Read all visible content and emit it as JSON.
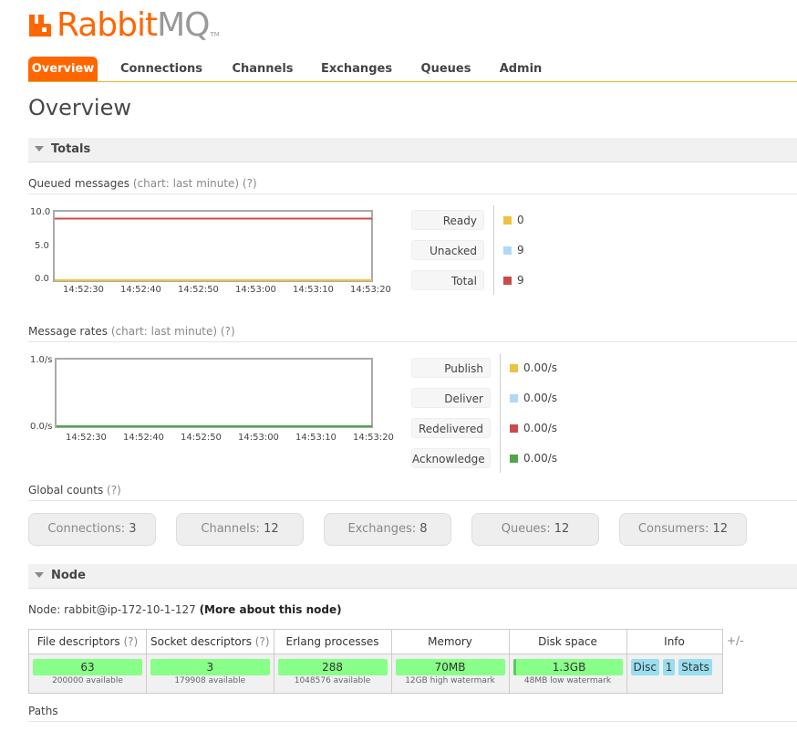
{
  "app": {
    "logo_rabbit": "Rabbit",
    "logo_mq": "MQ",
    "logo_tm": "TM"
  },
  "nav": {
    "tabs": [
      {
        "label": "Overview",
        "active": true
      },
      {
        "label": "Connections"
      },
      {
        "label": "Channels"
      },
      {
        "label": "Exchanges"
      },
      {
        "label": "Queues"
      },
      {
        "label": "Admin"
      }
    ]
  },
  "page_title": "Overview",
  "totals": {
    "section_title": "Totals",
    "queued": {
      "label": "Queued messages",
      "hint": "(chart: last minute) (?)",
      "legend": [
        {
          "label": "Ready",
          "value": "0",
          "color": "#edc240"
        },
        {
          "label": "Unacked",
          "value": "9",
          "color": "#afd8f8"
        },
        {
          "label": "Total",
          "value": "9",
          "color": "#cb4b4b"
        }
      ]
    },
    "rates": {
      "label": "Message rates",
      "hint": "(chart: last minute) (?)",
      "legend": [
        {
          "label": "Publish",
          "value": "0.00/s",
          "color": "#edc240"
        },
        {
          "label": "Deliver",
          "value": "0.00/s",
          "color": "#afd8f8"
        },
        {
          "label": "Redelivered",
          "value": "0.00/s",
          "color": "#cb4b4b"
        },
        {
          "label": "Acknowledge",
          "value": "0.00/s",
          "color": "#4da74d"
        }
      ]
    },
    "global_counts": {
      "label": "Global counts",
      "hint": "(?)",
      "items": [
        {
          "label": "Connections:",
          "value": "3"
        },
        {
          "label": "Channels:",
          "value": "12"
        },
        {
          "label": "Exchanges:",
          "value": "8"
        },
        {
          "label": "Queues:",
          "value": "12"
        },
        {
          "label": "Consumers:",
          "value": "12"
        }
      ]
    }
  },
  "chart_data": [
    {
      "type": "line",
      "x": [
        "14:52:30",
        "14:52:40",
        "14:52:50",
        "14:53:00",
        "14:53:10",
        "14:53:20"
      ],
      "yticks": [
        "10.0",
        "5.0",
        "0.0"
      ],
      "ylim": [
        0,
        10
      ],
      "series": [
        {
          "name": "Ready",
          "values": [
            0,
            0,
            0,
            0,
            0,
            0
          ],
          "color": "#edc240"
        },
        {
          "name": "Unacked",
          "values": [
            9,
            9,
            9,
            9,
            9,
            9
          ],
          "color": "#afd8f8"
        },
        {
          "name": "Total",
          "values": [
            9,
            9,
            9,
            9,
            9,
            9
          ],
          "color": "#cb4b4b"
        }
      ]
    },
    {
      "type": "line",
      "x": [
        "14:52:30",
        "14:52:40",
        "14:52:50",
        "14:53:00",
        "14:53:10",
        "14:53:20"
      ],
      "yticks": [
        "1.0/s",
        "0.0/s"
      ],
      "ylim": [
        0,
        1
      ],
      "series": [
        {
          "name": "Publish",
          "values": [
            0,
            0,
            0,
            0,
            0,
            0
          ],
          "color": "#edc240"
        },
        {
          "name": "Deliver",
          "values": [
            0,
            0,
            0,
            0,
            0,
            0
          ],
          "color": "#afd8f8"
        },
        {
          "name": "Redelivered",
          "values": [
            0,
            0,
            0,
            0,
            0,
            0
          ],
          "color": "#cb4b4b"
        },
        {
          "name": "Acknowledge",
          "values": [
            0,
            0,
            0,
            0,
            0,
            0
          ],
          "color": "#4da74d"
        }
      ]
    }
  ],
  "node": {
    "section_title": "Node",
    "node_prefix": "Node: rabbit@ip-172-10-1-127",
    "more_link": "(More about this node)",
    "headers": {
      "fd": "File descriptors",
      "fd_q": "(?)",
      "sd": "Socket descriptors",
      "sd_q": "(?)",
      "ep": "Erlang processes",
      "mem": "Memory",
      "disk": "Disk space",
      "info": "Info"
    },
    "values": {
      "fd": "63",
      "fd_cap": "200000 available",
      "sd": "3",
      "sd_cap": "179908 available",
      "ep": "288",
      "ep_cap": "1048576 available",
      "mem": "70MB",
      "mem_cap": "12GB high watermark",
      "disk": "1.3GB",
      "disk_cap": "48MB low watermark",
      "info_tags": [
        "Disc",
        "1",
        "Stats"
      ]
    },
    "plus_minus": "+/-"
  },
  "paths_label": "Paths"
}
